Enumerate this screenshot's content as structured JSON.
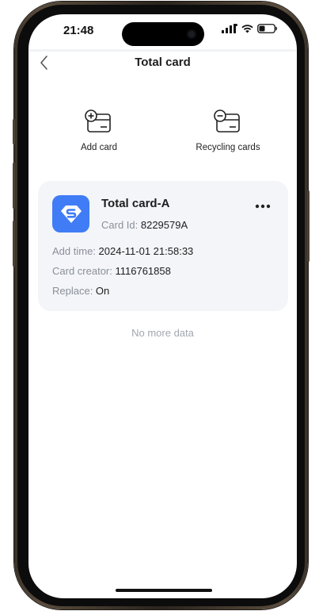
{
  "status_bar": {
    "time": "21:48"
  },
  "nav": {
    "title": "Total card"
  },
  "actions": {
    "add_label": "Add card",
    "recycle_label": "Recycling cards"
  },
  "card": {
    "name": "Total card-A",
    "id_label": "Card Id: ",
    "id_value": "8229579A",
    "add_time_label": "Add time: ",
    "add_time_value": "2024-11-01 21:58:33",
    "creator_label": "Card creator: ",
    "creator_value": "1116761858",
    "replace_label": "Replace: ",
    "replace_value": "On",
    "logo_color": "#3f7cf6"
  },
  "footer": {
    "note": "No more data"
  }
}
